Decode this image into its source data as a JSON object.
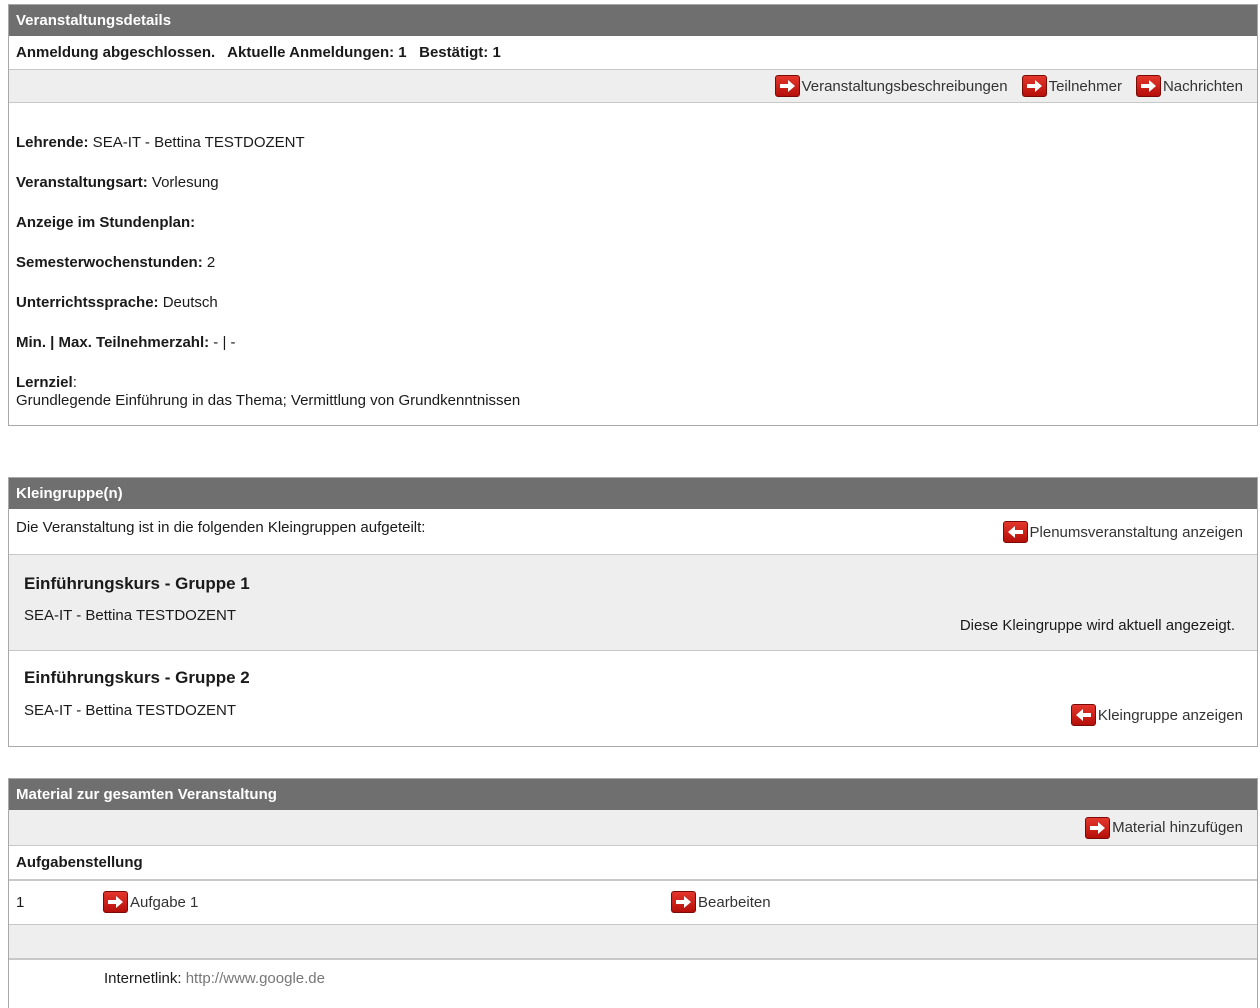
{
  "details": {
    "header": "Veranstaltungsdetails",
    "status": "Anmeldung abgeschlossen.   Aktuelle Anmeldungen: 1   Bestätigt: 1",
    "actions": [
      "Veranstaltungsbeschreibungen",
      "Teilnehmer",
      "Nachrichten"
    ],
    "fields": [
      {
        "label": "Lehrende:",
        "value": " SEA-IT - Bettina TESTDOZENT"
      },
      {
        "label": "Veranstaltungsart:",
        "value": " Vorlesung"
      },
      {
        "label": "Anzeige im Stundenplan:",
        "value": ""
      },
      {
        "label": "Semesterwochenstunden:",
        "value": " 2"
      },
      {
        "label": "Unterrichtssprache:",
        "value": " Deutsch"
      },
      {
        "label": "Min. | Max. Teilnehmerzahl:",
        "value": " - | -"
      }
    ],
    "lernziel_label": "Lernziel",
    "lernziel_colon": ":",
    "lernziel_text": "Grundlegende Einführung in das Thema; Vermittlung von Grundkenntnissen"
  },
  "kleingruppen": {
    "header": "Kleingruppe(n)",
    "intro": "Die Veranstaltung ist in die folgenden Kleingruppen aufgeteilt:",
    "plenum_link": "Plenumsveranstaltung anzeigen",
    "groups": [
      {
        "title": "Einführungskurs - Gruppe 1",
        "teacher": "SEA-IT - Bettina TESTDOZENT",
        "note": "Diese Kleingruppe wird aktuell angezeigt."
      },
      {
        "title": "Einführungskurs - Gruppe 2",
        "teacher": "SEA-IT - Bettina TESTDOZENT",
        "link": "Kleingruppe anzeigen"
      }
    ]
  },
  "material": {
    "header": "Material zur gesamten Veranstaltung",
    "add_link": "Material hinzufügen",
    "section": "Aufgabenstellung",
    "row_number": "1",
    "row_item": "Aufgabe 1",
    "row_edit": "Bearbeiten",
    "internet_label": "Internetlink:",
    "internet_url": "http://www.google.de"
  },
  "colors": {
    "header_bg": "#6f6f6f",
    "icon_red": "#d42a20",
    "row_gray": "#eeeeee"
  }
}
